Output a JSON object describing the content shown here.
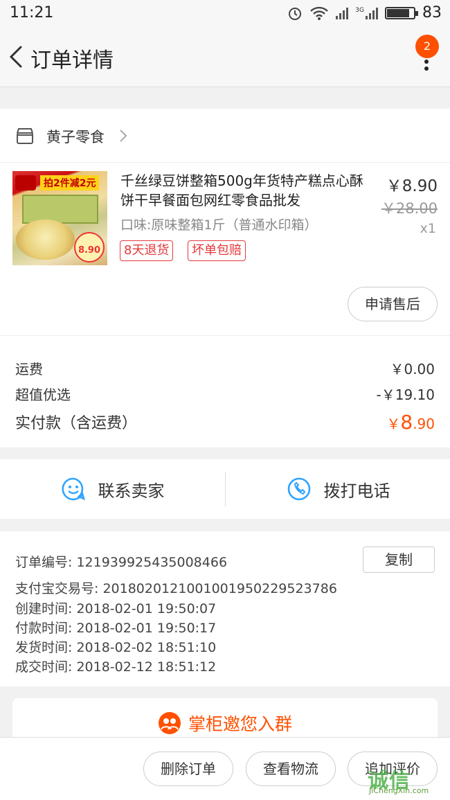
{
  "status_bar": {
    "time": "11:21",
    "battery": "83",
    "battery_fraction": 0.83,
    "network": "3G"
  },
  "nav": {
    "title": "订单详情",
    "badge_count": "2"
  },
  "shop": {
    "name": "黄子零食"
  },
  "product": {
    "title": "千丝绿豆饼整箱500g年货特产糕点心酥饼干早餐面包网红零食品批发",
    "spec": "口味:原味整箱1斤（普通水印箱）",
    "price": "￥8.90",
    "original_price": "￥28.00",
    "quantity": "x1",
    "tags": [
      "8天退货",
      "坏单包赔"
    ],
    "image_promo": "拍2件减2元",
    "image_price": "8.90"
  },
  "after_sale_button": "申请售后",
  "totals": {
    "shipping_label": "运费",
    "shipping_value": "￥0.00",
    "discount_label": "超值优选",
    "discount_value": "-￥19.10",
    "paid_label": "实付款（含运费）",
    "paid_currency": "￥",
    "paid_int": "8",
    "paid_dec": ".90"
  },
  "contact": {
    "seller": "联系卖家",
    "phone": "拨打电话"
  },
  "order_info": {
    "order_no": "订单编号:   121939925435008466",
    "alipay_no": "支付宝交易号:   2018020121001001950229523786",
    "created": "创建时间:   2018-02-01 19:50:07",
    "paid": "付款时间:   2018-02-01 19:50:17",
    "shipped": "发货时间:   2018-02-02 18:51:10",
    "completed": "成交时间:   2018-02-12 18:51:12",
    "copy_button": "复制"
  },
  "invite": {
    "text": "掌柜邀您入群"
  },
  "bottom_actions": [
    "删除订单",
    "查看物流",
    "追加评价"
  ],
  "watermark": {
    "big": "诚信",
    "small": "JiChengXin.com"
  },
  "colors": {
    "accent": "#ff5000",
    "tag_red": "#e4393c",
    "contact_blue": "#2fa4ff"
  }
}
